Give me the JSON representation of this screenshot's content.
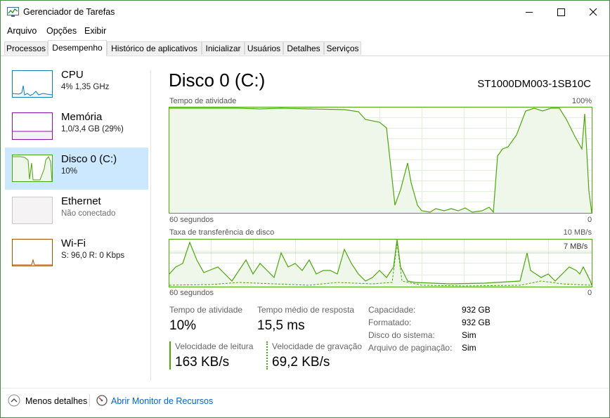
{
  "window": {
    "title": "Gerenciador de Tarefas",
    "app_icon": "task-manager-icon"
  },
  "menu": [
    "Arquivo",
    "Opções",
    "Exibir"
  ],
  "tabs": [
    "Processos",
    "Desempenho",
    "Histórico de aplicativos",
    "Inicializar",
    "Usuários",
    "Detalhes",
    "Serviços"
  ],
  "active_tab": "Desempenho",
  "sidebar": {
    "items": [
      {
        "title": "CPU",
        "sub": "4% 1,35 GHz",
        "color": "#117dbb"
      },
      {
        "title": "Memória",
        "sub": "1,0/3,4 GB (29%)",
        "color": "#8b12ae"
      },
      {
        "title": "Disco 0 (C:)",
        "sub": "10%",
        "color": "#4da60c"
      },
      {
        "title": "Ethernet",
        "sub": "Não conectado",
        "color": "#a74f01"
      },
      {
        "title": "Wi-Fi",
        "sub": "S: 96,0  R: 0 Kbps",
        "color": "#a74f01"
      }
    ]
  },
  "main": {
    "title": "Disco 0 (C:)",
    "model": "ST1000DM003-1SB10C",
    "graph1": {
      "label": "Tempo de atividade",
      "max": "100%",
      "time": "60 segundos",
      "min": "0"
    },
    "graph2": {
      "label": "Taxa de transferência de disco",
      "max": "10 MB/s",
      "line_label": "7 MB/s",
      "time": "60 segundos",
      "min": "0"
    },
    "stats": {
      "activity_label": "Tempo de atividade",
      "activity_value": "10%",
      "response_label": "Tempo médio de resposta",
      "response_value": "15,5 ms",
      "read_label": "Velocidade de leitura",
      "read_value": "163 KB/s",
      "write_label": "Velocidade de gravação",
      "write_value": "69,2 KB/s"
    },
    "info": [
      {
        "key": "Capacidade:",
        "value": "932 GB"
      },
      {
        "key": "Formatado:",
        "value": "932 GB"
      },
      {
        "key": "Disco do sistema:",
        "value": "Sim"
      },
      {
        "key": "Arquivo de paginação:",
        "value": "Sim"
      }
    ]
  },
  "footer": {
    "less_details": "Menos detalhes",
    "resource_monitor": "Abrir Monitor de Recursos"
  },
  "colors": {
    "disk_green": "#4da60c",
    "disk_fill": "#eff7ea",
    "selected_bg": "#cce8ff",
    "link_blue": "#0066cc"
  }
}
